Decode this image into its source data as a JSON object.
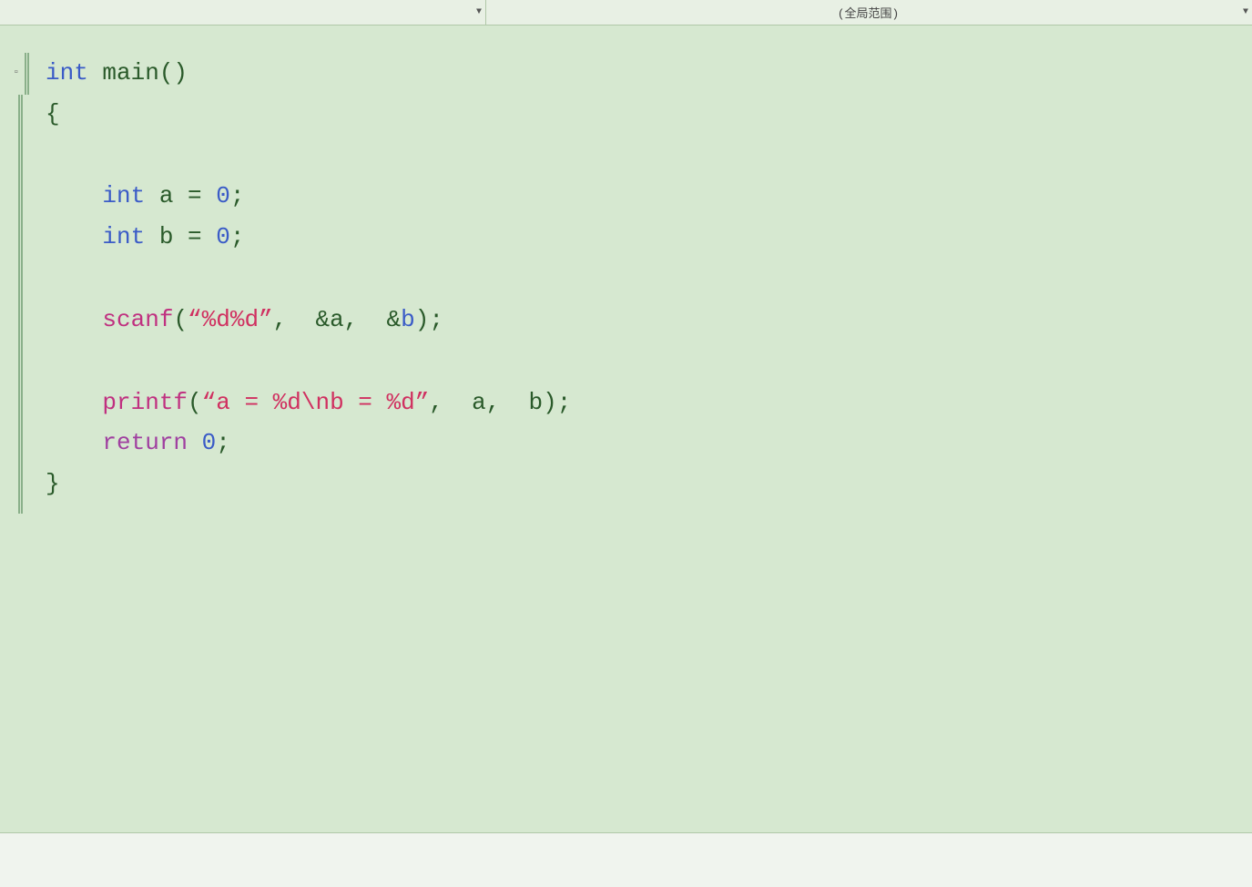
{
  "topbar": {
    "left_placeholder": "",
    "dropdown_arrow": "▼",
    "scope_label": "(全局范围)",
    "dropdown_arrow_right": "▼"
  },
  "code": {
    "lines": [
      {
        "id": 1,
        "tokens": [
          {
            "text": "int",
            "class": "kw-blue"
          },
          {
            "text": " main()",
            "class": "normal"
          }
        ],
        "fold": true
      },
      {
        "id": 2,
        "tokens": [
          {
            "text": "{",
            "class": "normal"
          }
        ],
        "fold": false
      },
      {
        "id": 3,
        "tokens": [],
        "empty": true
      },
      {
        "id": 4,
        "tokens": [
          {
            "text": "    ",
            "class": "normal"
          },
          {
            "text": "int",
            "class": "kw-blue"
          },
          {
            "text": " a = ",
            "class": "normal"
          },
          {
            "text": "0",
            "class": "num-blue"
          },
          {
            "text": ";",
            "class": "normal"
          }
        ],
        "fold": false
      },
      {
        "id": 5,
        "tokens": [
          {
            "text": "    ",
            "class": "normal"
          },
          {
            "text": "int",
            "class": "kw-blue"
          },
          {
            "text": " b = ",
            "class": "normal"
          },
          {
            "text": "0",
            "class": "num-blue"
          },
          {
            "text": ";",
            "class": "normal"
          }
        ],
        "fold": false
      },
      {
        "id": 6,
        "tokens": [],
        "empty": true
      },
      {
        "id": 7,
        "tokens": [
          {
            "text": "    ",
            "class": "normal"
          },
          {
            "text": "scanf",
            "class": "kw-magenta"
          },
          {
            "text": "(",
            "class": "normal"
          },
          {
            "text": "“%d%d”",
            "class": "str-red"
          },
          {
            "text": ",  &a,  &",
            "class": "normal"
          },
          {
            "text": "b",
            "class": "kw-blue"
          },
          {
            "text": ");",
            "class": "normal"
          }
        ],
        "fold": false
      },
      {
        "id": 8,
        "tokens": [],
        "empty": true
      },
      {
        "id": 9,
        "tokens": [
          {
            "text": "    ",
            "class": "normal"
          },
          {
            "text": "printf",
            "class": "kw-magenta"
          },
          {
            "text": "(",
            "class": "normal"
          },
          {
            "text": "“a = %d\\nb = %d”",
            "class": "str-red"
          },
          {
            "text": ",  a,  b);",
            "class": "normal"
          }
        ],
        "fold": false
      },
      {
        "id": 10,
        "tokens": [
          {
            "text": "    ",
            "class": "normal"
          },
          {
            "text": "return",
            "class": "kw-purple"
          },
          {
            "text": " ",
            "class": "normal"
          },
          {
            "text": "0",
            "class": "num-blue"
          },
          {
            "text": ";",
            "class": "normal"
          }
        ],
        "fold": false
      },
      {
        "id": 11,
        "tokens": [
          {
            "text": "}",
            "class": "normal"
          }
        ],
        "fold": false
      }
    ]
  }
}
